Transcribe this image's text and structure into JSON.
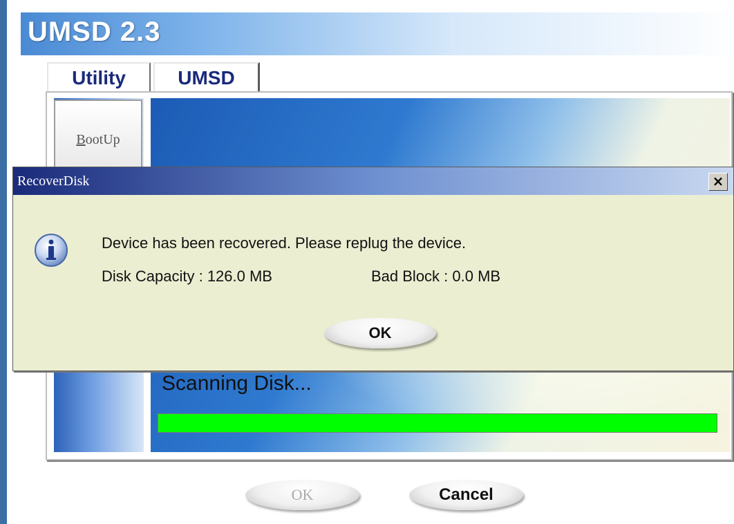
{
  "app": {
    "title": "UMSD 2.3",
    "tabs": [
      {
        "label": "Utility",
        "active": true
      },
      {
        "label": "UMSD",
        "active": false
      }
    ],
    "sidebar": {
      "bootup_prefix": "B",
      "bootup_rest": "ootUp"
    },
    "scan": {
      "label": "Scanning Disk...",
      "progress_fraction": 1.0,
      "progress_color": "#00ff00"
    },
    "buttons": {
      "ok_label": "OK",
      "cancel_label": "Cancel"
    }
  },
  "dialog": {
    "title": "RecoverDisk",
    "close_symbol": "×",
    "icon": "info-icon",
    "message": "Device has been recovered. Please replug the device.",
    "capacity": "Disk Capacity : 126.0 MB",
    "bad_block": "Bad Block : 0.0 MB",
    "ok_label": "OK"
  },
  "colors": {
    "window_border": "#3a6ea5",
    "dialog_bg": "#eceed2",
    "tab_text": "#1a2a7a"
  }
}
